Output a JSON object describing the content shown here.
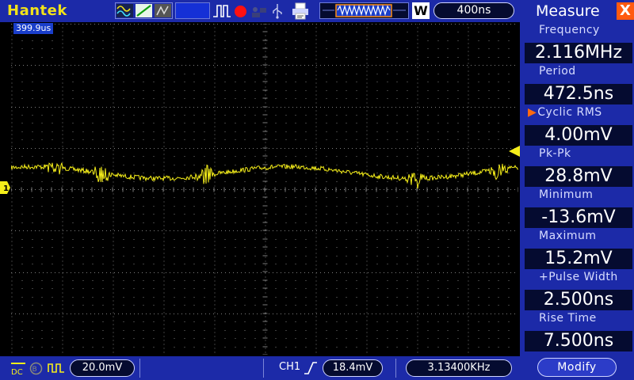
{
  "topbar": {
    "brand": "Hantek",
    "w_badge": "W",
    "timebase": "400ns",
    "icons": [
      "wave-select-icon",
      "slope-icon",
      "persist-icon",
      "pulse-icon",
      "run-stop-icon",
      "usb-icon",
      "print-icon"
    ]
  },
  "screen": {
    "trigger_position": "399.9us",
    "channel_marker": "1"
  },
  "bottombar": {
    "channel_volts": "20.0mV",
    "trigger_channel": "CH1",
    "trigger_level": "18.4mV",
    "frequency_counter": "3.13400KHz",
    "coupling_label": "DC"
  },
  "panel": {
    "title": "Measure",
    "close_label": "X",
    "measurements": [
      {
        "label": "Frequency",
        "value": "2.116MHz",
        "selected": false
      },
      {
        "label": "Period",
        "value": "472.5ns",
        "selected": false
      },
      {
        "label": "Cyclic RMS",
        "value": "4.00mV",
        "selected": true
      },
      {
        "label": "Pk-Pk",
        "value": "28.8mV",
        "selected": false
      },
      {
        "label": "Minimum",
        "value": "-13.6mV",
        "selected": false
      },
      {
        "label": "Maximum",
        "value": "15.2mV",
        "selected": false
      },
      {
        "label": "+Pulse Width",
        "value": "2.500ns",
        "selected": false
      },
      {
        "label": "Rise Time",
        "value": "7.500ns",
        "selected": false
      }
    ],
    "selected_marker": "▶",
    "modify_label": "Modify"
  },
  "colors": {
    "bar_blue": "#1c2aa8",
    "trace_yellow": "#f5ee1a",
    "grid_gray": "#7d7d7d",
    "accent_orange": "#ff5a10",
    "run_red": "#ff1010"
  }
}
